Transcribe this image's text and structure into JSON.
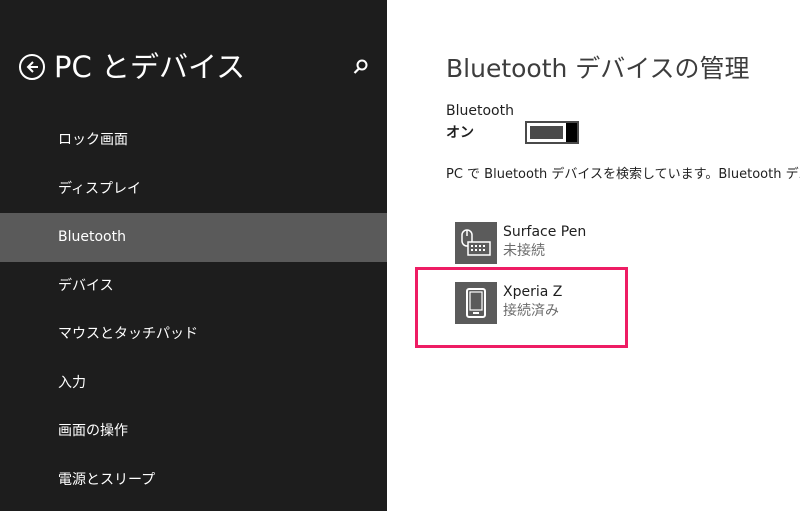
{
  "colors": {
    "sidebar_bg": "#1d1d1d",
    "selected_bg": "#5a5a5a",
    "highlight": "#ee1d64",
    "tile_bg": "#5b5b5b"
  },
  "sidebar": {
    "title": "PC とデバイス",
    "back_icon": "back-arrow-icon",
    "search_icon": "search-icon",
    "items": [
      {
        "label": "ロック画面"
      },
      {
        "label": "ディスプレイ"
      },
      {
        "label": "Bluetooth",
        "selected": true
      },
      {
        "label": "デバイス"
      },
      {
        "label": "マウスとタッチパッド"
      },
      {
        "label": "入力"
      },
      {
        "label": "画面の操作"
      },
      {
        "label": "電源とスリープ"
      }
    ]
  },
  "main": {
    "title": "Bluetooth デバイスの管理",
    "bluetooth_label": "Bluetooth",
    "bluetooth_state": "オン",
    "bluetooth_on": true,
    "search_status": "PC で Bluetooth デバイスを検索しています。Bluetooth デバイス",
    "devices": [
      {
        "name": "Surface Pen",
        "status": "未接続",
        "icon": "mouse-keyboard-icon"
      },
      {
        "name": "Xperia Z",
        "status": "接続済み",
        "icon": "phone-icon",
        "highlighted": true
      }
    ]
  }
}
